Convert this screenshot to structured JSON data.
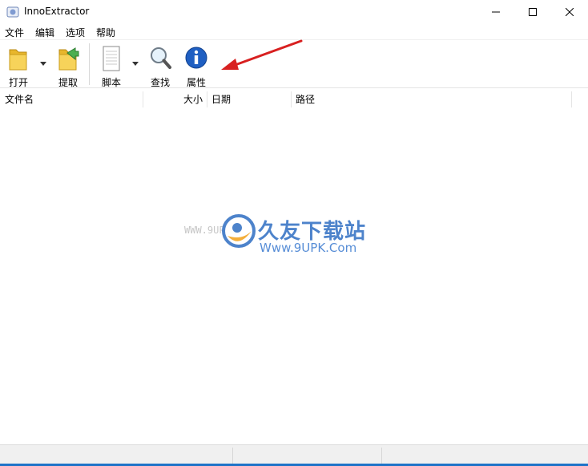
{
  "window": {
    "title": "InnoExtractor"
  },
  "menu": [
    "文件",
    "编辑",
    "选项",
    "帮助"
  ],
  "toolbar": {
    "open_label": "打开",
    "extract_label": "提取",
    "script_label": "脚本",
    "find_label": "查找",
    "properties_label": "属性"
  },
  "columns": [
    "文件名",
    "大小",
    "日期",
    "路径"
  ],
  "watermark": {
    "cn": "久友下载站",
    "url": "Www.9UPK.Com",
    "www": "WWW.9UPK.COM"
  },
  "colors": {
    "accent": "#1e73c8",
    "annotation": "#d82020",
    "watermark": "#2f6ec3"
  }
}
